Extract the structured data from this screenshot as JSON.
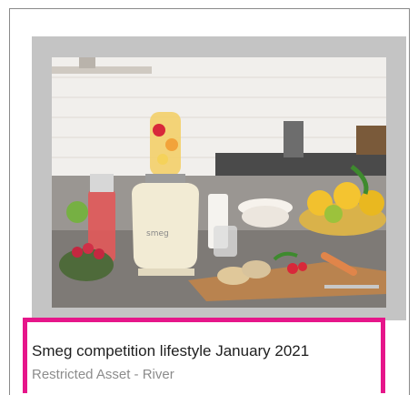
{
  "asset": {
    "title": "Smeg competition lifestyle January 2021",
    "subtitle": "Restricted Asset - River"
  },
  "colors": {
    "highlight": "#e6168a",
    "frame": "#c4c4c4",
    "title_text": "#1e1e1e",
    "subtitle_text": "#8c8c8c"
  },
  "icons": [
    "asset-thumbnail-image"
  ]
}
